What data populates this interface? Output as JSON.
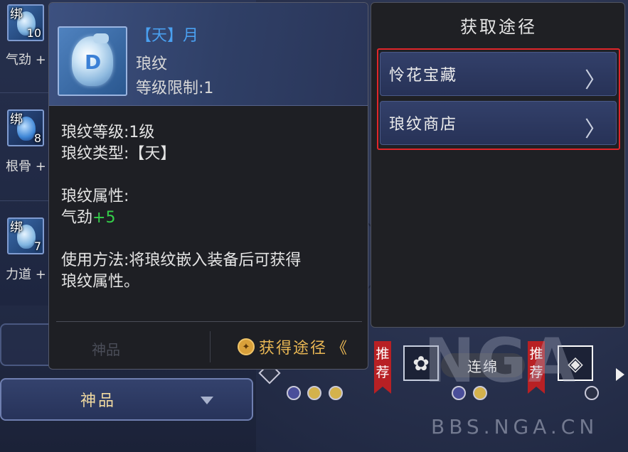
{
  "left_list": {
    "items": [
      {
        "bind_label": "绑",
        "count": "10",
        "attr": "气劲 +"
      },
      {
        "bind_label": "绑",
        "count": "8",
        "attr": "根骨 +"
      },
      {
        "bind_label": "绑",
        "count": "7",
        "attr": "力道 +"
      }
    ]
  },
  "grade_select": {
    "label": "神品"
  },
  "tooltip": {
    "name": "【天】月",
    "type": "琅纹",
    "level_req": "等级限制:1",
    "stat_level": "琅纹等级:1级",
    "stat_type": "琅纹类型:【天】",
    "attr_title": "琅纹属性:",
    "attr_name": "气劲",
    "attr_value": "+5",
    "usage_line1": "使用方法:将琅纹嵌入装备后可获得",
    "usage_line2": "琅纹属性。",
    "obtain_label": "获得途径",
    "obtain_chevron": "《"
  },
  "source_panel": {
    "title": "获取途径",
    "options": [
      {
        "label": "怜花宝藏"
      },
      {
        "label": "琅纹商店"
      }
    ]
  },
  "bottom_strip": {
    "recommend_tags": [
      "推荐",
      "推荐"
    ],
    "chain_label": "连绵"
  },
  "watermark": {
    "logo": "NGA",
    "url": "BBS.NGA.CN"
  },
  "colors": {
    "rarity_tian": "#4aa0f0",
    "attr_bonus": "#35d04a",
    "obtain_gold": "#e9b754",
    "highlight_red": "#e0262a"
  },
  "icons": {
    "obtain": "coin-icon",
    "option_chevron": "chevron-right-icon",
    "grade_dropdown": "chevron-down-icon"
  }
}
